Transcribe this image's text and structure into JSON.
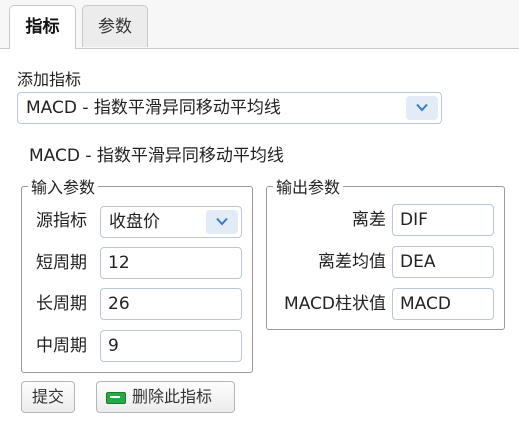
{
  "tabs": [
    {
      "label": "指标",
      "active": true
    },
    {
      "label": "参数",
      "active": false
    }
  ],
  "add_indicator": {
    "label": "添加指标",
    "selected": "MACD - 指数平滑异同移动平均线"
  },
  "indicator_heading": "MACD - 指数平滑异同移动平均线",
  "input_params": {
    "legend": "输入参数",
    "source": {
      "label": "源指标",
      "value": "收盘价"
    },
    "short": {
      "label": "短周期",
      "value": "12"
    },
    "long": {
      "label": "长周期",
      "value": "26"
    },
    "mid": {
      "label": "中周期",
      "value": "9"
    }
  },
  "output_params": {
    "legend": "输出参数",
    "dif": {
      "label": "离差",
      "value": "DIF"
    },
    "dea": {
      "label": "离差均值",
      "value": "DEA"
    },
    "macd": {
      "label": "MACD柱状值",
      "value": "MACD"
    }
  },
  "buttons": {
    "submit": "提交",
    "delete": "删除此指标"
  },
  "colors": {
    "accent": "#e3ecf6",
    "delete_icon": "#27a844"
  }
}
